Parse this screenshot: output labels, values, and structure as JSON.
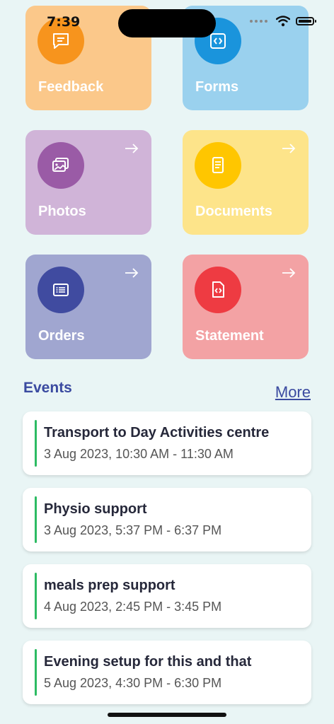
{
  "status_bar": {
    "time": "7:39",
    "icons": [
      "wifi-icon",
      "battery-icon"
    ]
  },
  "tiles": [
    {
      "label": "Feedback",
      "icon": "chat-bubble-icon",
      "bg": "#fbc88a",
      "circle": "#f7941d"
    },
    {
      "label": "Forms",
      "icon": "code-icon",
      "bg": "#9ad1ee",
      "circle": "#1a94dc"
    },
    {
      "label": "Photos",
      "icon": "photo-icon",
      "bg": "#d0b4d8",
      "circle": "#9a5ba6"
    },
    {
      "label": "Documents",
      "icon": "document-icon",
      "bg": "#fde48a",
      "circle": "#ffc600"
    },
    {
      "label": "Orders",
      "icon": "list-icon",
      "bg": "#a0a6d0",
      "circle": "#404ba0"
    },
    {
      "label": "Statement",
      "icon": "code-file-icon",
      "bg": "#f3a2a4",
      "circle": "#ee3b42"
    }
  ],
  "events": {
    "title": "Events",
    "more_label": "More",
    "accent": "#2dbb63",
    "items": [
      {
        "title": "Transport to Day Activities centre",
        "time": "3 Aug 2023, 10:30 AM - 11:30 AM"
      },
      {
        "title": "Physio support",
        "time": "3 Aug 2023, 5:37 PM - 6:37 PM"
      },
      {
        "title": "meals prep support",
        "time": "4 Aug 2023, 2:45 PM - 3:45 PM"
      },
      {
        "title": "Evening setup for this and that",
        "time": "5 Aug 2023, 4:30 PM - 6:30 PM"
      }
    ]
  }
}
